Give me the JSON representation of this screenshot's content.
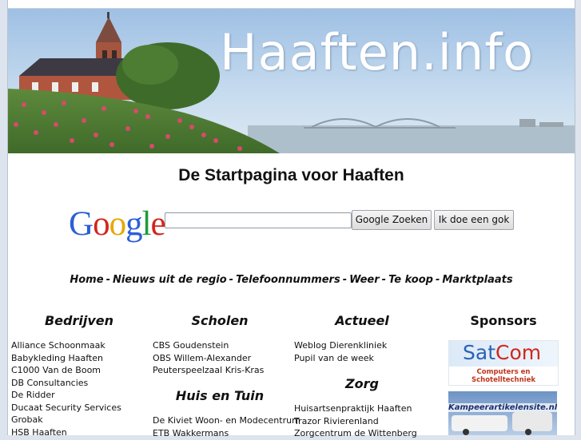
{
  "site": {
    "title": "Haaften.info"
  },
  "heading": "De Startpagina voor Haaften",
  "search": {
    "logo_letters": [
      "G",
      "o",
      "o",
      "g",
      "l",
      "e"
    ],
    "input_value": "",
    "search_button": "Google Zoeken",
    "lucky_button": "Ik doe een gok"
  },
  "nav": {
    "items": [
      "Home",
      "Nieuws uit de regio",
      "Telefoonnummers",
      "Weer",
      "Te koop",
      "Marktplaats"
    ],
    "separator": "-"
  },
  "columns": {
    "bedrijven": {
      "title": "Bedrijven",
      "items": [
        "Alliance Schoonmaak",
        "Babykleding Haaften",
        "C1000 Van de Boom",
        "DB Consultancies",
        "De Ridder",
        "Ducaat Security Services",
        "Grobak",
        "HSB Haaften"
      ]
    },
    "scholen": {
      "title": "Scholen",
      "items": [
        "CBS Goudenstein",
        "OBS Willem-Alexander",
        "Peuterspeelzaal Kris-Kras"
      ]
    },
    "huis_tuin": {
      "title": "Huis en Tuin",
      "items": [
        "De Kiviet Woon- en Modecentrum",
        "ETB Wakkermans"
      ]
    },
    "actueel": {
      "title": "Actueel",
      "items": [
        "Weblog Dierenkliniek",
        "Pupil van de week"
      ]
    },
    "zorg": {
      "title": "Zorg",
      "items": [
        "Huisartsenpraktijk Haaften",
        "Trazor Rivierenland",
        "Zorgcentrum de Wittenberg"
      ]
    },
    "sponsors": {
      "title": "Sponsors",
      "satcom_logo_a": "Sat",
      "satcom_logo_b": "Com",
      "satcom_sub": "Computers en Schotelltechniek",
      "kamp_text": "Kampeerartikelensite.nl"
    }
  },
  "colors": {
    "background": "#dde4ee",
    "google_blue": "#2b5fd6",
    "google_red": "#d2261e",
    "google_yellow": "#e6a800",
    "google_green": "#1f9b3a"
  }
}
